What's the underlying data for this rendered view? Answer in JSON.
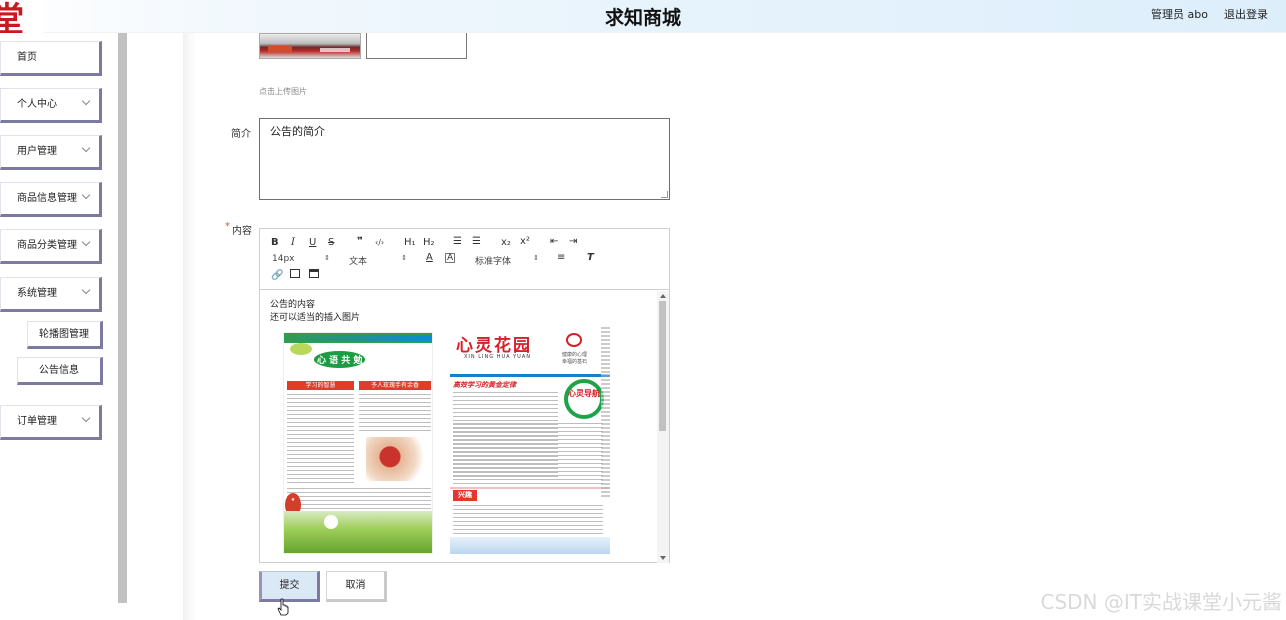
{
  "header": {
    "logo_glyph": "堂",
    "title": "求知商城",
    "user": "管理员 abo",
    "logout": "退出登录"
  },
  "sidebar": {
    "items": [
      {
        "label": "首页",
        "has_chevron": false
      },
      {
        "label": "个人中心",
        "has_chevron": true
      },
      {
        "label": "用户管理",
        "has_chevron": true
      },
      {
        "label": "商品信息管理",
        "has_chevron": true
      },
      {
        "label": "商品分类管理",
        "has_chevron": true
      },
      {
        "label": "系统管理",
        "has_chevron": true
      },
      {
        "label": "订单管理",
        "has_chevron": true
      }
    ],
    "subitems": [
      {
        "label": "轮播图管理"
      },
      {
        "label": "公告信息"
      }
    ]
  },
  "form": {
    "upload_hint": "点击上传图片",
    "intro_label": "简介",
    "intro_value": "公告的简介",
    "content_required": "*",
    "content_label": "内容",
    "editor": {
      "toolbar": {
        "bold": "B",
        "italic": "I",
        "underline": "U",
        "strike": "S",
        "quote": "❞",
        "code": "‹/›",
        "h1": "H₁",
        "h2": "H₂",
        "ol": "☰",
        "ul": "☰",
        "sub": "x₂",
        "sup": "x²",
        "outdent": "⇤",
        "indent": "⇥",
        "size_value": "14px",
        "block_value": "文本",
        "font_value": "标准字体"
      },
      "content_lines": [
        "公告的内容",
        "还可以适当的插入图片"
      ],
      "image1": {
        "masthead": "心 语 共 勉",
        "col1_head": "学习的智慧",
        "col2_head": "予人玫瑰手有余香",
        "side_text": "香有余"
      },
      "image2": {
        "title": "心灵花园",
        "pinyin": "XIN LING HUA YUAN",
        "slogan1": "健康的心理",
        "slogan2": "幸福的基石",
        "sub_head": "高效学习的黄金定律",
        "badge": "心灵导航",
        "interest": "兴趣"
      }
    },
    "submit": "提交",
    "cancel": "取消"
  },
  "watermark": "CSDN @IT实战课堂小元酱",
  "colors": {
    "menu_shadow": "#7d7aa0",
    "header_gradient_end": "#ddeefb",
    "submit_bg": "#dbe9f7",
    "required": "#e64a3c"
  }
}
